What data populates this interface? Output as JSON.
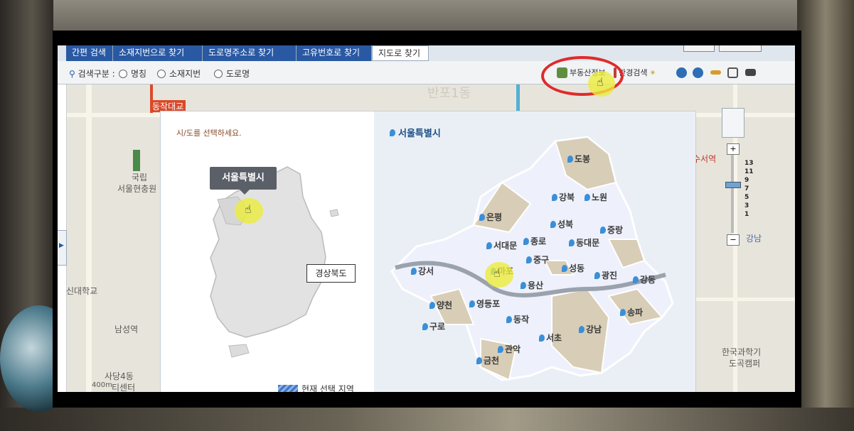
{
  "tabs": [
    {
      "label": "간편 검색"
    },
    {
      "label": "소재지번으로 찾기"
    },
    {
      "label": "도로명주소로 찾기"
    },
    {
      "label": "고유번호로 찾기"
    },
    {
      "label": "지도로 찾기"
    }
  ],
  "active_tab": "지도로 찾기",
  "search": {
    "label": "검색구분 :",
    "options": [
      "명칭",
      "소재지번",
      "도로명"
    ]
  },
  "toolbar": {
    "realestate_label": "부동산정보",
    "radius_label": "반경검색"
  },
  "map_labels": {
    "place1": "국립",
    "place2": "서울현충원",
    "place3": "동작대교",
    "place4": "반포1동",
    "place5": "신대학교",
    "place6": "남성역",
    "place7": "사당4동",
    "place8": "티센터",
    "place9": "한국과학기",
    "place10": "도곡캠퍼",
    "place11": "수서역",
    "place12": "강남",
    "scale": "400m"
  },
  "zoom_levels": [
    "13",
    "11",
    "9",
    "7",
    "5",
    "3",
    "1"
  ],
  "panel": {
    "prompt": "시/도를 선택하세요.",
    "tooltip": "서울특별시",
    "province_box": "경상북도",
    "right_title": "서울특별시",
    "legend": "현재 선택 지역"
  },
  "districts": [
    {
      "name": "도봉"
    },
    {
      "name": "강북"
    },
    {
      "name": "노원"
    },
    {
      "name": "은평"
    },
    {
      "name": "성북"
    },
    {
      "name": "중랑"
    },
    {
      "name": "종로"
    },
    {
      "name": "서대문"
    },
    {
      "name": "동대문"
    },
    {
      "name": "중구"
    },
    {
      "name": "성동"
    },
    {
      "name": "광진"
    },
    {
      "name": "강서"
    },
    {
      "name": "마포"
    },
    {
      "name": "용산"
    },
    {
      "name": "강동"
    },
    {
      "name": "양천"
    },
    {
      "name": "영등포"
    },
    {
      "name": "송파"
    },
    {
      "name": "동작"
    },
    {
      "name": "구로"
    },
    {
      "name": "서초"
    },
    {
      "name": "강남"
    },
    {
      "name": "관악"
    },
    {
      "name": "금천"
    }
  ],
  "colors": {
    "tab_blue": "#2a59a3",
    "highlight_ring": "#e02a2a",
    "cursor_highlight": "#ecec3c",
    "title_blue": "#1d4f87",
    "district_tan": "#d8cdb6",
    "district_light": "#eef0fb"
  }
}
